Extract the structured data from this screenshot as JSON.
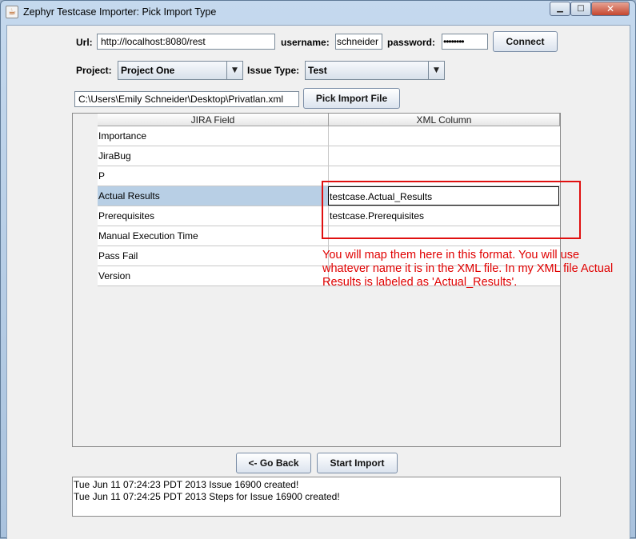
{
  "window": {
    "title": "Zephyr Testcase Importer: Pick Import Type",
    "app_icon_glyph": "☕",
    "minimize_glyph": "▁",
    "maximize_glyph": "□",
    "close_glyph": "✕"
  },
  "connection": {
    "url_label": "Url:",
    "url_value": "http://localhost:8080/rest",
    "username_label": "username:",
    "username_value": "schneider",
    "password_label": "password:",
    "password_value": "••••••••",
    "connect_label": "Connect"
  },
  "project": {
    "project_label": "Project:",
    "project_value": "Project One",
    "issue_type_label": "Issue Type:",
    "issue_type_value": "Test",
    "dropdown_glyph": "▼"
  },
  "file": {
    "path_value": "C:\\Users\\Emily Schneider\\Desktop\\Privatlan.xml",
    "pick_label": "Pick Import File"
  },
  "table": {
    "headers": [
      "JIRA Field",
      "XML Column"
    ],
    "rows": [
      {
        "field": "Importance",
        "xml": ""
      },
      {
        "field": "JiraBug",
        "xml": ""
      },
      {
        "field": "P",
        "xml": ""
      },
      {
        "field": "Actual Results",
        "xml": "testcase.Actual_Results"
      },
      {
        "field": "Prerequisites",
        "xml": "testcase.Prerequisites"
      },
      {
        "field": "Manual Execution Time",
        "xml": ""
      },
      {
        "field": "Pass Fail",
        "xml": ""
      },
      {
        "field": "Version",
        "xml": ""
      }
    ],
    "selected_row": 3
  },
  "annotation": {
    "text": "You will map them here in this format. You will use whatever name it is in the XML file. In my XML file Actual Results is labeled as 'Actual_Results'.",
    "color": "#e00000"
  },
  "actions": {
    "back_label": "<- Go Back",
    "import_label": "Start Import"
  },
  "log": {
    "lines": [
      "Tue Jun 11 07:24:23 PDT 2013 Issue 16900 created!",
      "Tue Jun 11 07:24:25 PDT 2013 Steps for Issue 16900 created!"
    ]
  }
}
